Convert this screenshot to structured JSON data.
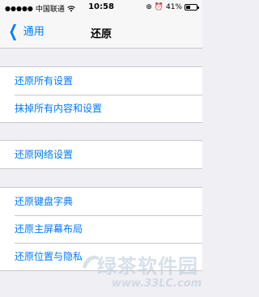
{
  "status_bar": {
    "signal": "●●●●●",
    "carrier": "中国联通",
    "time": "10:58",
    "battery_percent": "41%",
    "battery_level": 0.41
  },
  "nav": {
    "back_label": "通用",
    "title": "还原"
  },
  "groups": [
    {
      "items": [
        "还原所有设置",
        "抹掉所有内容和设置"
      ]
    },
    {
      "items": [
        "还原网络设置"
      ]
    },
    {
      "items": [
        "还原键盘字典",
        "还原主屏幕布局",
        "还原位置与隐私"
      ]
    }
  ],
  "watermark": {
    "text": "绿茶软件园",
    "url": "www.33LC.com"
  },
  "colors": {
    "accent": "#007aff",
    "background": "#efeff4"
  }
}
